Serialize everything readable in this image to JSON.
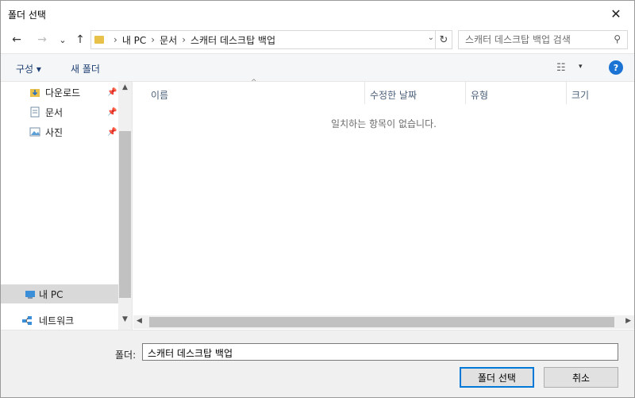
{
  "window": {
    "title": "폴더 선택",
    "close_glyph": "✕"
  },
  "nav": {
    "back_glyph": "←",
    "forward_glyph": "→",
    "recent_glyph": "⌄",
    "up_glyph": "↑",
    "breadcrumb": [
      "내 PC",
      "문서",
      "스캐터 데스크탑 백업"
    ],
    "breadcrumb_sep": "›",
    "dropdown_glyph": "⌄",
    "refresh_glyph": "↻",
    "search_placeholder": "스캐터 데스크탑 백업 검색",
    "search_icon_glyph": "⚲"
  },
  "toolbar": {
    "organize_label": "구성 ▾",
    "new_folder_label": "새 폴더",
    "view_icon_glyph": "☷",
    "view_dropdown_glyph": "▾",
    "help_label": "?"
  },
  "sidebar": {
    "items": [
      {
        "label": "다운로드",
        "icon": "download-folder-icon",
        "pinned": true,
        "pin_glyph": "📌"
      },
      {
        "label": "문서",
        "icon": "documents-icon",
        "pinned": true,
        "pin_glyph": "📌"
      },
      {
        "label": "사진",
        "icon": "pictures-icon",
        "pinned": true,
        "pin_glyph": "📌"
      },
      {
        "label": "내 PC",
        "icon": "computer-icon",
        "selected": true
      },
      {
        "label": "네트워크",
        "icon": "network-icon"
      }
    ],
    "scroll_up_glyph": "▲",
    "scroll_down_glyph": "▼"
  },
  "filelist": {
    "columns": [
      "이름",
      "수정한 날짜",
      "유형",
      "크기"
    ],
    "sort_glyph": "^",
    "empty_message": "일치하는 항목이 없습니다.",
    "scroll_left_glyph": "◀",
    "scroll_right_glyph": "▶"
  },
  "footer": {
    "folder_label": "폴더:",
    "folder_value": "스캐터 데스크탑 백업",
    "select_button": "폴더 선택",
    "cancel_button": "취소"
  },
  "colors": {
    "accent": "#0078d7",
    "folder_yellow": "#e8c14a",
    "help_blue": "#1b73d3",
    "link_blue": "#1e3f73"
  }
}
